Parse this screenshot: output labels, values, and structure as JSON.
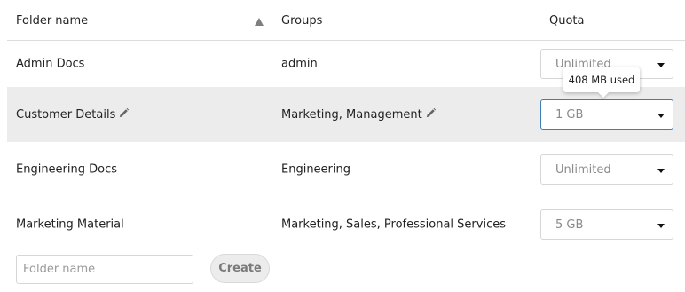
{
  "table": {
    "headers": {
      "folder_name": "Folder name",
      "groups": "Groups",
      "quota": "Quota"
    },
    "rows": [
      {
        "folder_name": "Admin Docs",
        "groups": "admin",
        "quota": "Unlimited",
        "editable": false
      },
      {
        "folder_name": "Customer Details",
        "groups": "Marketing, Management",
        "quota": "1 GB",
        "editable": true
      },
      {
        "folder_name": "Engineering Docs",
        "groups": "Engineering",
        "quota": "Unlimited",
        "editable": false
      },
      {
        "folder_name": "Marketing Material",
        "groups": "Marketing, Sales, Professional Services",
        "quota": "5 GB",
        "editable": false
      }
    ]
  },
  "tooltip": {
    "text": "408 MB used"
  },
  "new_folder": {
    "placeholder": "Folder name",
    "create_label": "Create"
  },
  "colors": {
    "highlight_row": "#ececec",
    "focus_border": "#3d7fb5"
  }
}
